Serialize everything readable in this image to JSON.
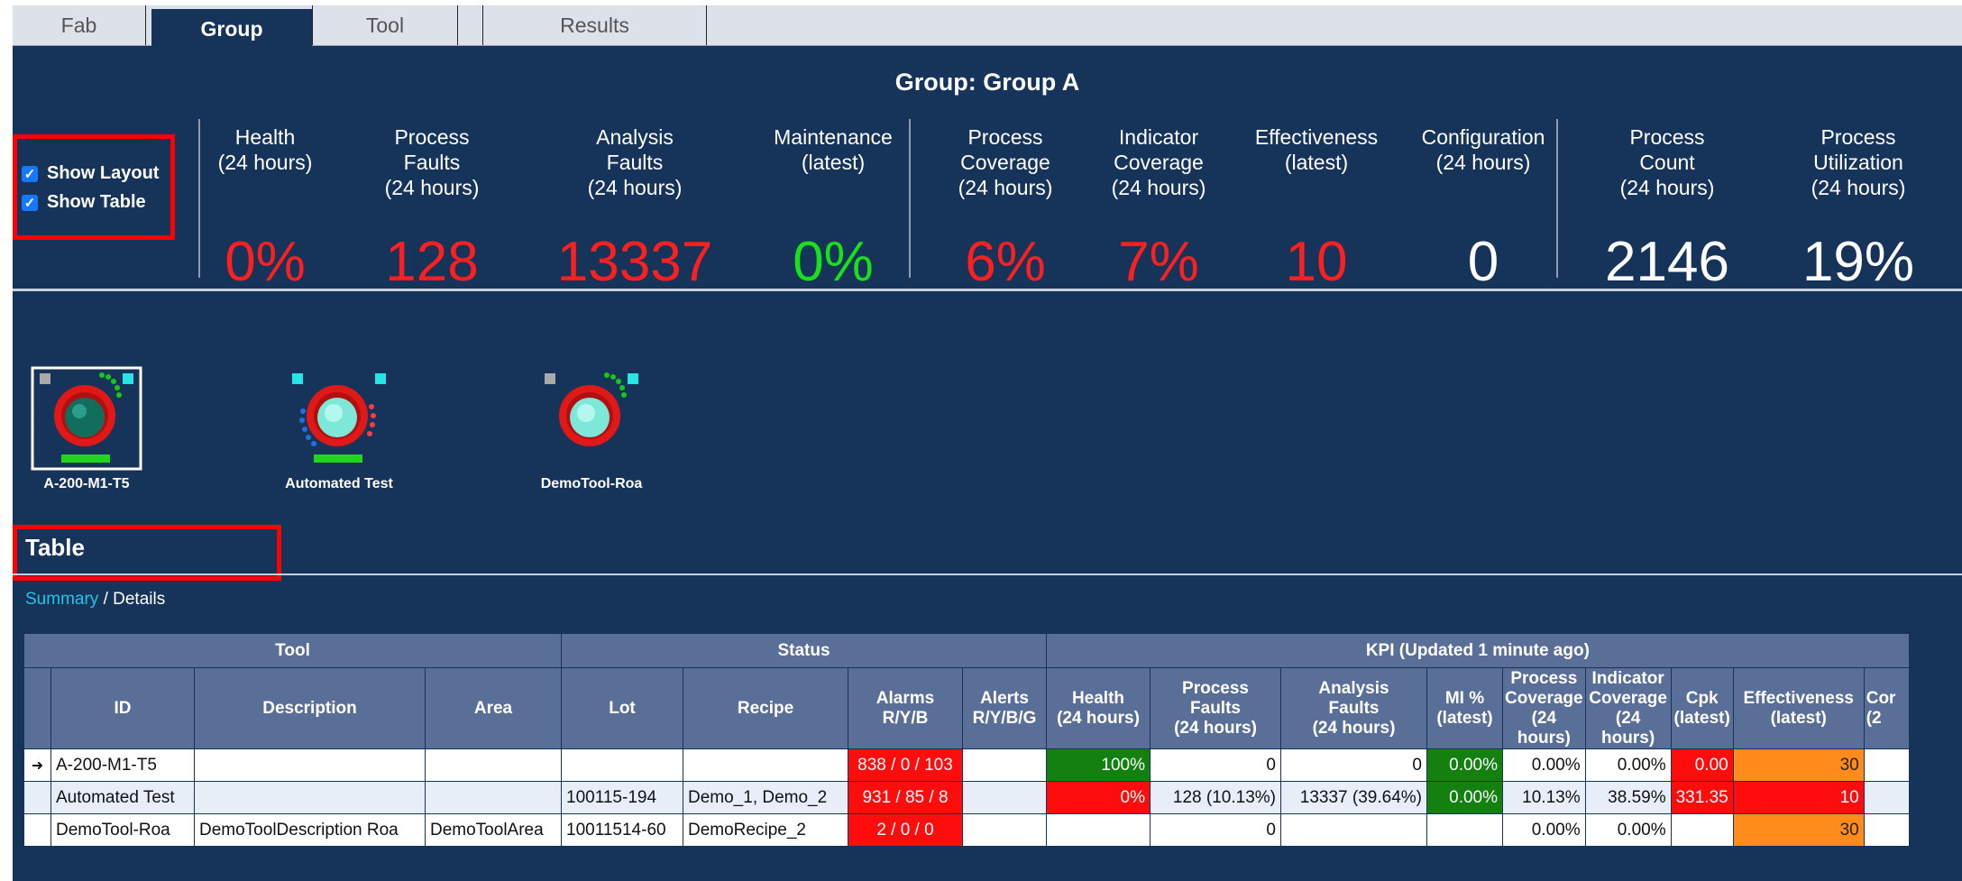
{
  "tabs": [
    "Fab",
    "Group",
    "Tool",
    "",
    "Results"
  ],
  "group_title": "Group: Group A",
  "options": {
    "show_layout": "Show Layout",
    "show_table": "Show Table"
  },
  "kpis": [
    {
      "label": "Health\n(24 hours)",
      "value": "0%",
      "color": "#ff1f1f"
    },
    {
      "label": "Process\nFaults\n(24 hours)",
      "value": "128",
      "color": "#ff1f1f"
    },
    {
      "label": "Analysis\nFaults\n(24 hours)",
      "value": "13337",
      "color": "#ff1f1f"
    },
    {
      "label": "Maintenance\n(latest)",
      "value": "0%",
      "color": "#19e119"
    },
    {
      "label": "Process\nCoverage\n(24 hours)",
      "value": "6%",
      "color": "#ff1f1f"
    },
    {
      "label": "Indicator\nCoverage\n(24 hours)",
      "value": "7%",
      "color": "#ff1f1f"
    },
    {
      "label": "Effectiveness\n(latest)",
      "value": "10",
      "color": "#ff1f1f"
    },
    {
      "label": "Configuration\n(24 hours)",
      "value": "0",
      "color": "#ffffff"
    },
    {
      "label": "Process\nCount\n(24 hours)",
      "value": "2146",
      "color": "#ffffff"
    },
    {
      "label": "Process\nUtilization\n(24 hours)",
      "value": "19%",
      "color": "#ffffff"
    }
  ],
  "tools": [
    {
      "name": "A-200-M1-T5",
      "selected": true
    },
    {
      "name": "Automated Test",
      "selected": false
    },
    {
      "name": "DemoTool-Roa",
      "selected": false
    }
  ],
  "table_title": "Table",
  "views": {
    "summary": "Summary",
    "separator": " / ",
    "details": "Details"
  },
  "table": {
    "groups": [
      "Tool",
      "Status",
      "KPI (Updated 1 minute ago)"
    ],
    "columns": [
      {
        "label": "ID"
      },
      {
        "label": "Description"
      },
      {
        "label": "Area"
      },
      {
        "label": "Lot"
      },
      {
        "label": "Recipe"
      },
      {
        "label": "Alarms\nR/Y/B"
      },
      {
        "label": "Alerts\nR/Y/B/G"
      },
      {
        "label": "Health\n(24 hours)"
      },
      {
        "label": "Process\nFaults\n(24 hours)"
      },
      {
        "label": "Analysis\nFaults\n(24 hours)"
      },
      {
        "label": "MI %\n(latest)"
      },
      {
        "label": "Process\nCoverage\n(24 hours)"
      },
      {
        "label": "Indicator\nCoverage\n(24 hours)"
      },
      {
        "label": "Cpk\n(latest)"
      },
      {
        "label": "Effectiveness\n(latest)"
      },
      {
        "label": "Cor\n(2"
      }
    ],
    "rows": [
      {
        "current": true,
        "id": "A-200-M1-T5",
        "description": "",
        "area": "",
        "lot": "",
        "recipe": "",
        "alarms": "838 / 0 / 103",
        "alerts": "",
        "health": "100%",
        "process_faults": "0",
        "analysis_faults": "0",
        "mi": "0.00%",
        "process_coverage": "0.00%",
        "indicator_coverage": "0.00%",
        "cpk": "0.00",
        "effectiveness": "30",
        "config": ""
      },
      {
        "current": false,
        "id": "Automated Test",
        "description": "",
        "area": "",
        "lot": "100115-194",
        "recipe": "Demo_1, Demo_2",
        "alarms": "931 / 85 / 8",
        "alerts": "",
        "health": "0%",
        "process_faults": "128 (10.13%)",
        "analysis_faults": "13337 (39.64%)",
        "mi": "0.00%",
        "process_coverage": "10.13%",
        "indicator_coverage": "38.59%",
        "cpk": "331.35",
        "effectiveness": "10",
        "config": ""
      },
      {
        "current": false,
        "id": "DemoTool-Roa",
        "description": "DemoToolDescription Roa",
        "area": "DemoToolArea",
        "lot": "10011514-60",
        "recipe": "DemoRecipe_2",
        "alarms": "2 / 0 / 0",
        "alerts": "",
        "health": "",
        "process_faults": "0",
        "analysis_faults": "",
        "mi": "",
        "process_coverage": "0.00%",
        "indicator_coverage": "0.00%",
        "cpk": "",
        "effectiveness": "30",
        "config": ""
      }
    ]
  }
}
